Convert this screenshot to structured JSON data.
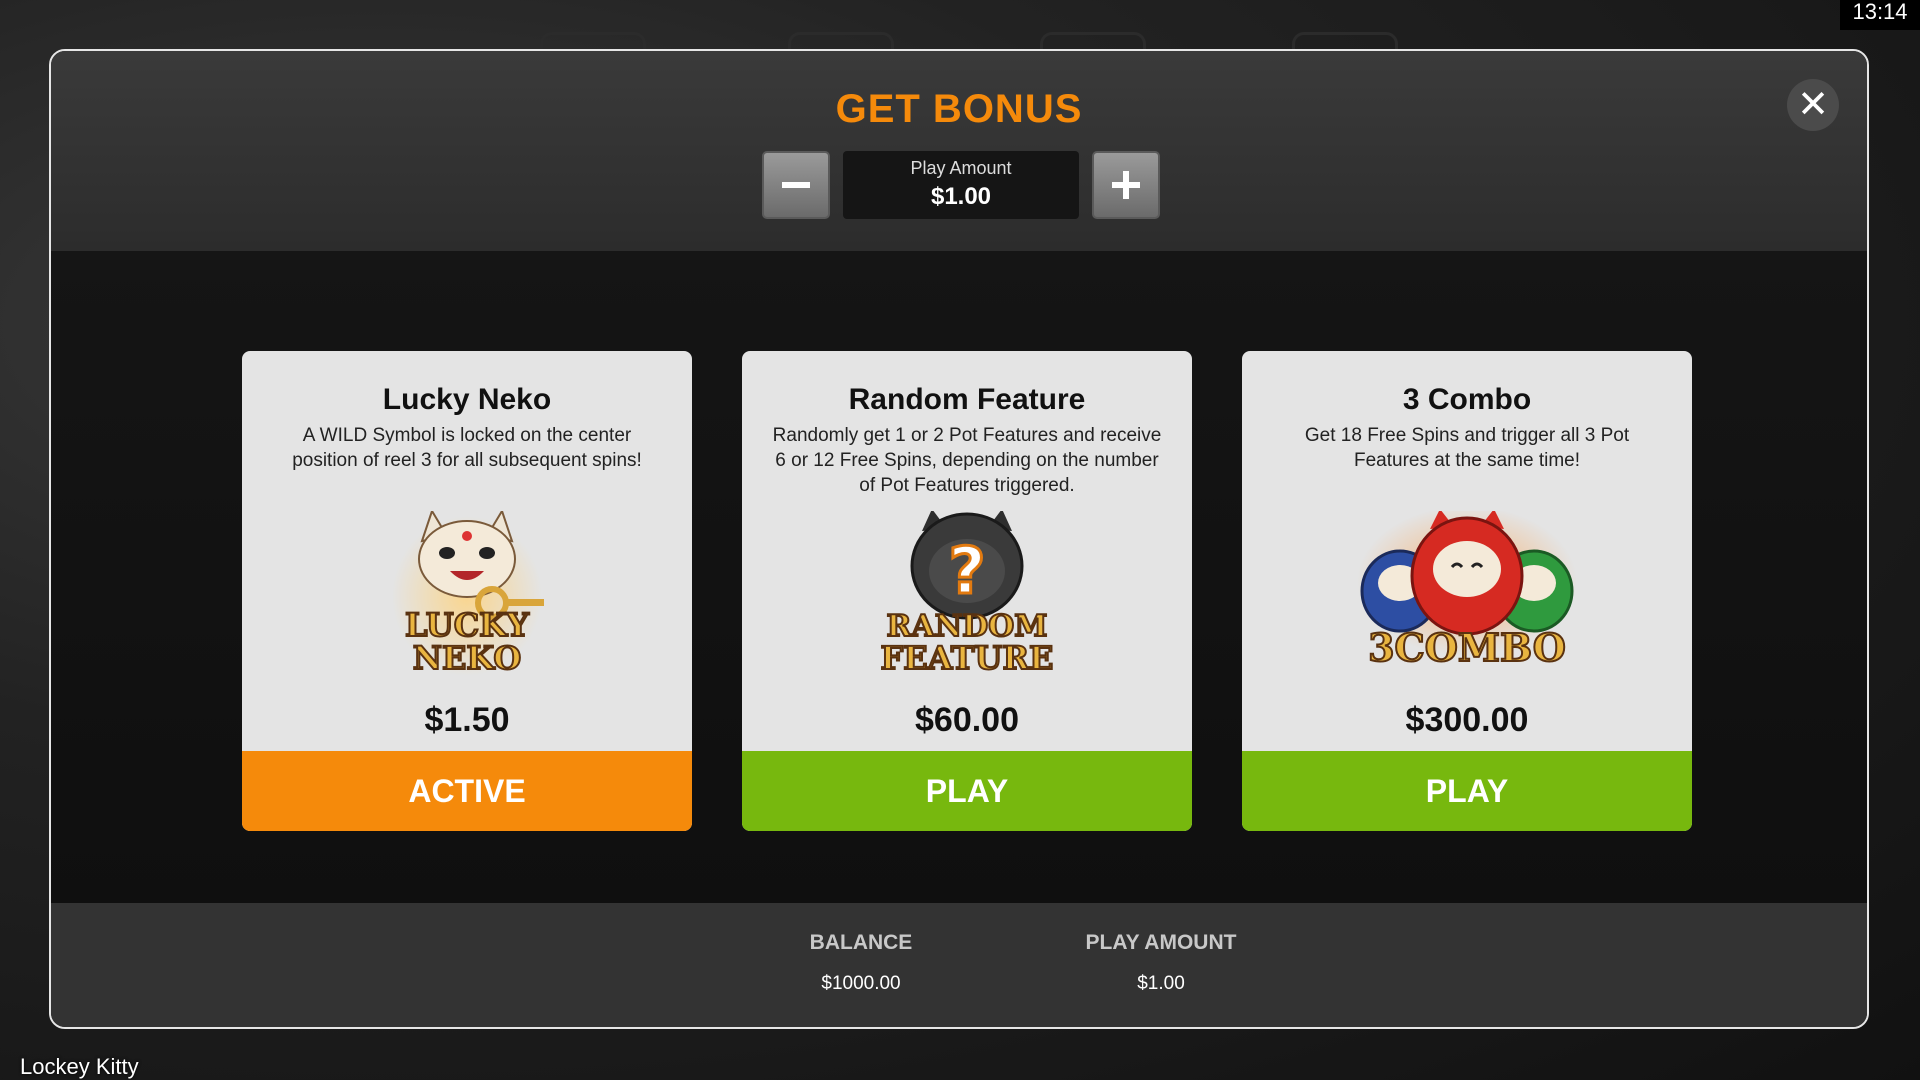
{
  "status_bar": {
    "time": "13:14"
  },
  "game": {
    "title": "Lockey Kitty"
  },
  "modal": {
    "title": "GET BONUS",
    "close_icon": "close-icon",
    "play_amount_label": "Play Amount",
    "play_amount_value": "$1.00",
    "minus_icon": "minus-icon",
    "plus_icon": "plus-icon"
  },
  "features": [
    {
      "name": "Lucky Neko",
      "description": "A WILD Symbol is locked on the center position of reel 3 for all subsequent spins!",
      "logo_text": [
        "LUCKY",
        "NEKO"
      ],
      "price": "$1.50",
      "button": "ACTIVE"
    },
    {
      "name": "Random Feature",
      "description": "Randomly get 1 or 2 Pot Features and receive 6 or 12 Free Spins, depending on the number of Pot Features triggered.",
      "logo_text": [
        "RANDOM",
        "FEATURE"
      ],
      "price": "$60.00",
      "button": "PLAY"
    },
    {
      "name": "3 Combo",
      "description": "Get 18 Free Spins and trigger all 3 Pot Features at the same time!",
      "logo_text": [
        "3COMBO"
      ],
      "price": "$300.00",
      "button": "PLAY"
    }
  ],
  "footer": {
    "balance_label": "BALANCE",
    "balance_value": "$1000.00",
    "play_amount_label": "PLAY AMOUNT",
    "play_amount_value": "$1.00"
  },
  "colors": {
    "accent_orange": "#f58a0b",
    "play_green": "#77b80e",
    "card_bg": "#e4e4e4"
  }
}
